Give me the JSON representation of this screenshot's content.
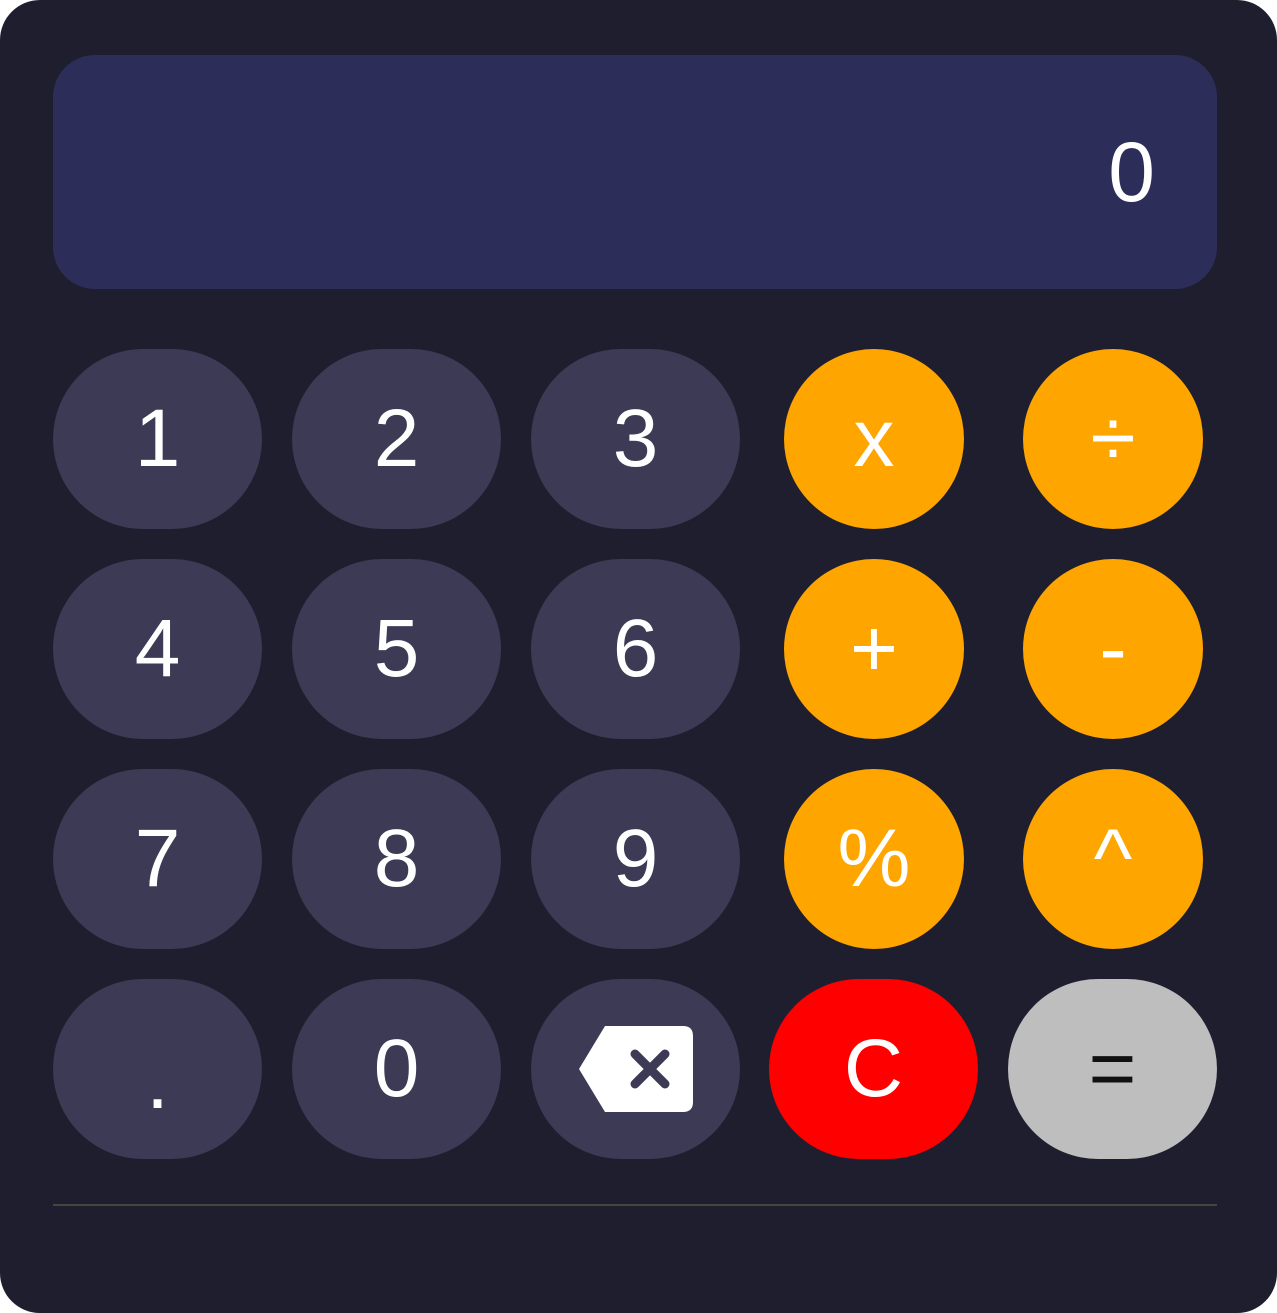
{
  "display": {
    "value": "0"
  },
  "keys": {
    "row1": [
      "1",
      "2",
      "3",
      "x",
      "÷"
    ],
    "row2": [
      "4",
      "5",
      "6",
      "+",
      "-"
    ],
    "row3": [
      "7",
      "8",
      "9",
      "%",
      "^"
    ],
    "row4": [
      ".",
      "0",
      "backspace-icon",
      "C",
      "="
    ]
  },
  "labels": {
    "k1": "1",
    "k2": "2",
    "k3": "3",
    "multiply": "x",
    "divide": "÷",
    "k4": "4",
    "k5": "5",
    "k6": "6",
    "plus": "+",
    "minus": "-",
    "k7": "7",
    "k8": "8",
    "k9": "9",
    "percent": "%",
    "power": "^",
    "dot": ".",
    "k0": "0",
    "clear": "C",
    "equals": "="
  },
  "colors": {
    "background": "#1f1e2f",
    "display": "#2d2d5a",
    "number_key": "#3c3a54",
    "operator_key": "#ffa500",
    "clear_key": "#ff0000",
    "equals_key": "#bebebe",
    "text": "#ffffff"
  }
}
